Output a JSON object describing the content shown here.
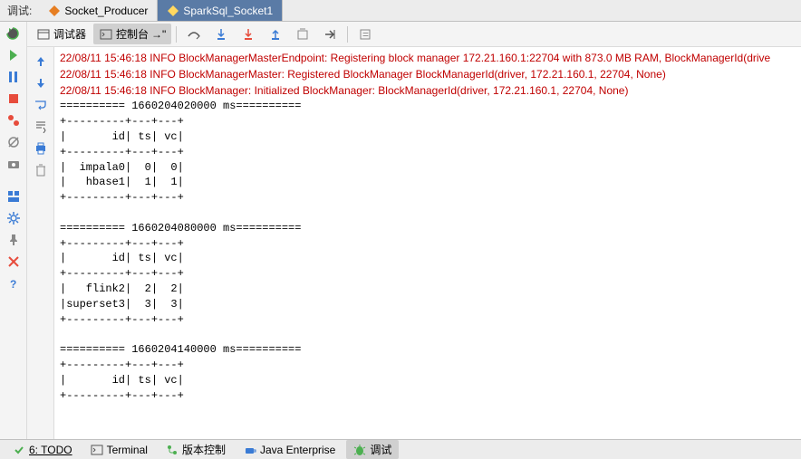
{
  "header": {
    "label": "调试:",
    "tabs": [
      {
        "label": "Socket_Producer",
        "active": false
      },
      {
        "label": "SparkSql_Socket1",
        "active": true
      }
    ]
  },
  "toolbar2": {
    "debugger": "调试器",
    "console": "控制台"
  },
  "console_output": {
    "log_lines": [
      "22/08/11 15:46:18 INFO BlockManagerMasterEndpoint: Registering block manager 172.21.160.1:22704 with 873.0 MB RAM, BlockManagerId(drive",
      "22/08/11 15:46:18 INFO BlockManagerMaster: Registered BlockManager BlockManagerId(driver, 172.21.160.1, 22704, None)",
      "22/08/11 15:46:18 INFO BlockManager: Initialized BlockManager: BlockManagerId(driver, 172.21.160.1, 22704, None)"
    ],
    "blocks": [
      {
        "ts": "1660204020000 ms",
        "rows": [
          [
            "impala0",
            "0",
            "0"
          ],
          [
            "hbase1",
            "1",
            "1"
          ]
        ]
      },
      {
        "ts": "1660204080000 ms",
        "rows": [
          [
            "flink2",
            "2",
            "2"
          ],
          [
            "superset3",
            "3",
            "3"
          ]
        ]
      },
      {
        "ts": "1660204140000 ms",
        "rows": []
      }
    ],
    "cols": [
      "id",
      "ts",
      "vc"
    ]
  },
  "bottombar": {
    "todo": "6: TODO",
    "terminal": "Terminal",
    "vcs": "版本控制",
    "java": "Java Enterprise",
    "debug": "调试"
  },
  "chart_data": {
    "type": "table",
    "columns": [
      "id",
      "ts",
      "vc"
    ],
    "series": [
      {
        "name": "1660204020000",
        "rows": [
          [
            "impala0",
            0,
            0
          ],
          [
            "hbase1",
            1,
            1
          ]
        ]
      },
      {
        "name": "1660204080000",
        "rows": [
          [
            "flink2",
            2,
            2
          ],
          [
            "superset3",
            3,
            3
          ]
        ]
      },
      {
        "name": "1660204140000",
        "rows": []
      }
    ]
  }
}
